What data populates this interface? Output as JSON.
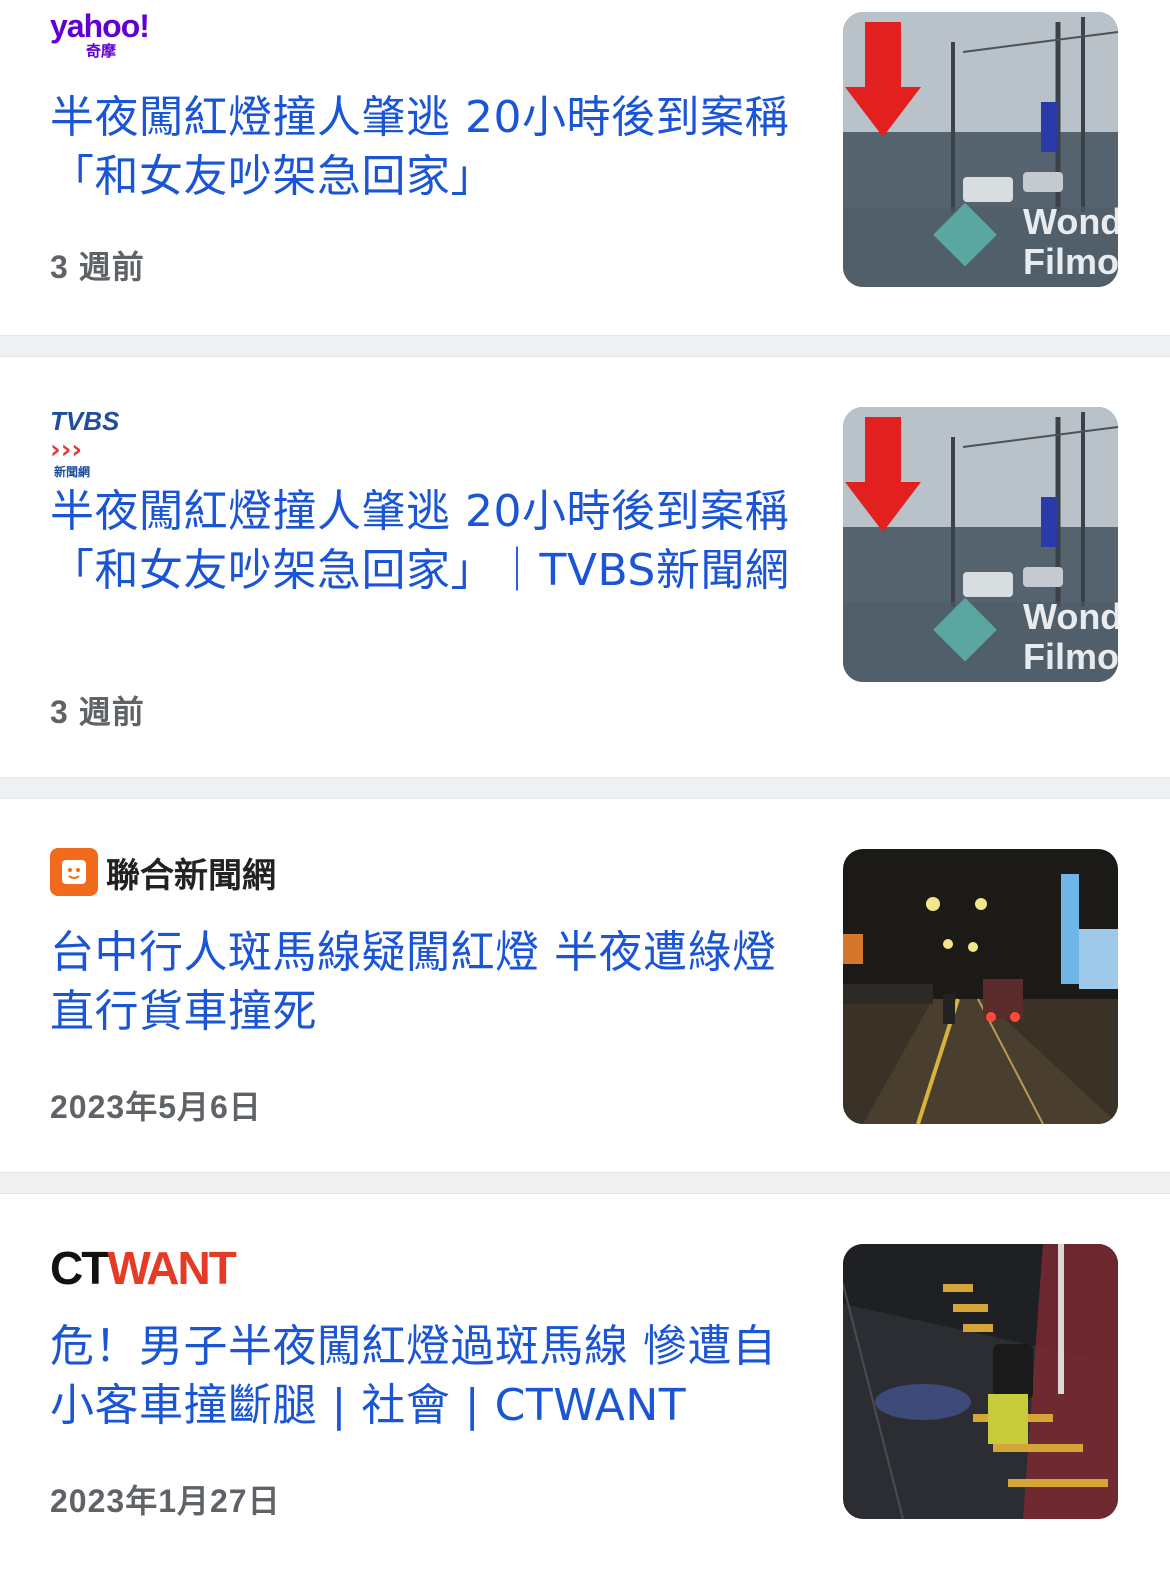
{
  "articles": [
    {
      "source": "yahoo!",
      "source_sub": "奇摩",
      "title": "半夜闖紅燈撞人肇逃 20小時後到案稱「和女友吵架急回家」",
      "time": "3 週前",
      "thumb": "dashcam-arrow",
      "watermark": "Wond\nFilmo"
    },
    {
      "source": "TVBS",
      "source_sub": "新聞網",
      "title": "半夜闖紅燈撞人肇逃 20小時後到案稱「和女友吵架急回家」｜TVBS新聞網",
      "time": "3 週前",
      "thumb": "dashcam-arrow",
      "watermark": "Wond\nFilmo"
    },
    {
      "source": "聯合新聞網",
      "title": "台中行人斑馬線疑闖紅燈 半夜遭綠燈直行貨車撞死",
      "time": "2023年5月6日",
      "thumb": "night-road"
    },
    {
      "source": "CTWANT",
      "title": "危！男子半夜闖紅燈過斑馬線 慘遭自小客車撞斷腿 | 社會 | CTWANT",
      "time": "2023年1月27日",
      "thumb": "accident-scene"
    }
  ],
  "colors": {
    "title": "#1a55d6",
    "time": "#5f6368",
    "yahoo": "#6001d2",
    "udn": "#f26b1d",
    "ctwant_accent": "#e53a26",
    "separator": "#eef0f2"
  }
}
